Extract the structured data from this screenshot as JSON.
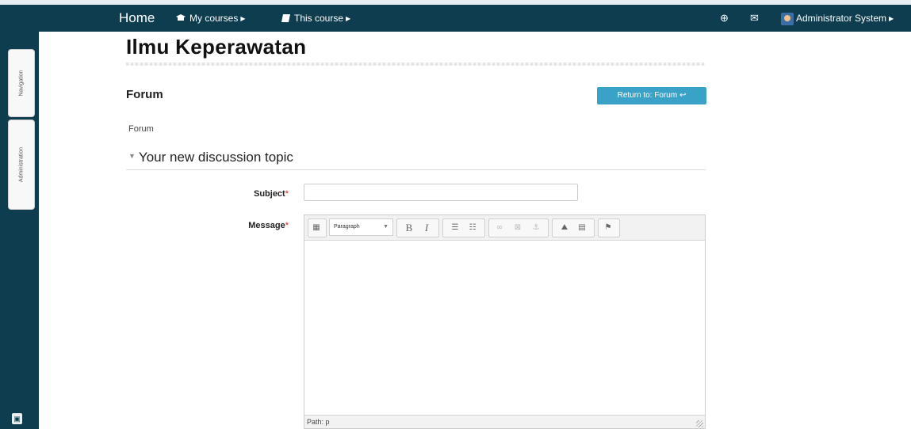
{
  "navbar": {
    "home": "Home",
    "my_courses": "My courses",
    "this_course": "This course",
    "user_name": "Administrator System"
  },
  "dock": {
    "navigation": "Navigation",
    "administration": "Administration"
  },
  "page": {
    "course_title": "Ilmu Keperawatan",
    "heading": "Forum",
    "return_button": "Return to: Forum",
    "breadcrumb": "Forum",
    "section_title": "Your new discussion topic"
  },
  "form": {
    "subject_label": "Subject",
    "subject_value": "",
    "message_label": "Message",
    "required_mark": "*"
  },
  "editor": {
    "format_select": "Paragraph",
    "toolbar_icons": [
      "toggle-toolbar-icon",
      "bold-icon",
      "italic-icon",
      "bullet-list-icon",
      "numbered-list-icon",
      "link-icon",
      "unlink-icon",
      "anchor-icon",
      "image-icon",
      "media-icon",
      "manage-files-icon"
    ],
    "path_label": "Path: p"
  },
  "colors": {
    "navbar_bg": "#0d3d4f",
    "button_bg": "#3aa1c7",
    "required": "#cc2222"
  }
}
